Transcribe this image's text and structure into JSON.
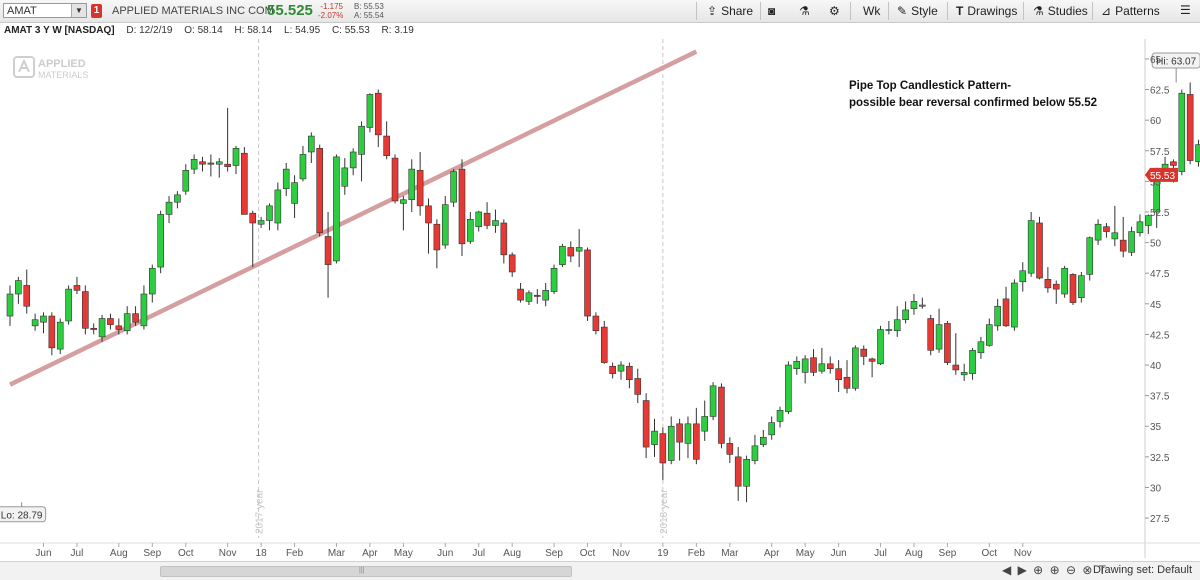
{
  "toolbar": {
    "symbol": "AMAT",
    "alert_count": "1",
    "company_name": "APPLIED MATERIALS INC COM",
    "last_price": "55.525",
    "change": "-1.175",
    "change_pct": "-2.07%",
    "bid": "B: 55.53",
    "ask": "A: 55.54",
    "share_label": "Share",
    "interval_label": "Wk",
    "style_label": "Style",
    "drawings_label": "Drawings",
    "studies_label": "Studies",
    "patterns_label": "Patterns"
  },
  "infobar": {
    "symbol_desc": "AMAT 3 Y W [NASDAQ]",
    "date": "D: 12/2/19",
    "open": "O: 58.14",
    "high": "H: 58.14",
    "low": "L: 54.95",
    "close": "C: 55.53",
    "range": "R: 3.19"
  },
  "bottom": {
    "drawing_set": "Drawing set: Default"
  },
  "colors": {
    "up": "#2ecc40",
    "down": "#e53935",
    "trendline": "#d49a9a",
    "axis_text": "#555555"
  },
  "chart_data": {
    "type": "candlestick",
    "watermark": [
      "APPLIED",
      "MATERIALS"
    ],
    "y_ticks": [
      65,
      62.5,
      60,
      57.5,
      55,
      52.5,
      50,
      47.5,
      45,
      42.5,
      40,
      37.5,
      35,
      32.5,
      30,
      27.5
    ],
    "ylim": [
      26.2,
      66.3
    ],
    "x_labels": [
      {
        "label": "Jun",
        "i": 4
      },
      {
        "label": "Jul",
        "i": 8
      },
      {
        "label": "Aug",
        "i": 13
      },
      {
        "label": "Sep",
        "i": 17
      },
      {
        "label": "Oct",
        "i": 21
      },
      {
        "label": "Nov",
        "i": 26
      },
      {
        "label": "18",
        "i": 30
      },
      {
        "label": "Feb",
        "i": 34
      },
      {
        "label": "Mar",
        "i": 39
      },
      {
        "label": "Apr",
        "i": 43
      },
      {
        "label": "May",
        "i": 47
      },
      {
        "label": "Jun",
        "i": 52
      },
      {
        "label": "Jul",
        "i": 56
      },
      {
        "label": "Aug",
        "i": 60
      },
      {
        "label": "Sep",
        "i": 65
      },
      {
        "label": "Oct",
        "i": 69
      },
      {
        "label": "Nov",
        "i": 73
      },
      {
        "label": "19",
        "i": 78
      },
      {
        "label": "Feb",
        "i": 82
      },
      {
        "label": "Mar",
        "i": 86
      },
      {
        "label": "Apr",
        "i": 91
      },
      {
        "label": "May",
        "i": 95
      },
      {
        "label": "Jun",
        "i": 99
      },
      {
        "label": "Jul",
        "i": 104
      },
      {
        "label": "Aug",
        "i": 108
      },
      {
        "label": "Sep",
        "i": 112
      },
      {
        "label": "Oct",
        "i": 117
      },
      {
        "label": "Nov",
        "i": 121
      }
    ],
    "year_markers": [
      {
        "label": "2017 year",
        "i": 29.7
      },
      {
        "label": "2018 year",
        "i": 78.0
      }
    ],
    "candles": [
      [
        44.0,
        46.5,
        43.2,
        45.8
      ],
      [
        45.8,
        47.2,
        45.0,
        46.9
      ],
      [
        46.5,
        47.8,
        44.2,
        44.8
      ],
      [
        43.2,
        44.2,
        42.8,
        43.7
      ],
      [
        43.5,
        44.3,
        42.6,
        44.0
      ],
      [
        44.0,
        44.3,
        40.8,
        41.4
      ],
      [
        41.3,
        43.8,
        40.9,
        43.5
      ],
      [
        43.6,
        46.5,
        43.3,
        46.2
      ],
      [
        46.5,
        47.2,
        45.8,
        46.1
      ],
      [
        46.0,
        46.5,
        42.5,
        43.0
      ],
      [
        43.0,
        43.4,
        42.5,
        42.9
      ],
      [
        42.3,
        44.1,
        41.9,
        43.8
      ],
      [
        43.8,
        44.2,
        42.9,
        43.3
      ],
      [
        43.2,
        43.8,
        42.5,
        42.9
      ],
      [
        42.8,
        44.8,
        42.5,
        44.2
      ],
      [
        44.2,
        44.8,
        43.2,
        43.5
      ],
      [
        43.2,
        46.5,
        42.9,
        45.8
      ],
      [
        45.8,
        48.2,
        45.1,
        47.9
      ],
      [
        48.0,
        52.6,
        47.5,
        52.3
      ],
      [
        52.3,
        53.8,
        51.6,
        53.3
      ],
      [
        53.3,
        54.2,
        52.8,
        53.9
      ],
      [
        54.2,
        56.4,
        53.9,
        55.9
      ],
      [
        56.0,
        57.2,
        55.6,
        56.8
      ],
      [
        56.6,
        57.0,
        55.8,
        56.4
      ],
      [
        56.5,
        57.2,
        55.4,
        56.4
      ],
      [
        56.4,
        56.9,
        55.3,
        56.6
      ],
      [
        56.4,
        61.0,
        55.8,
        56.2
      ],
      [
        56.3,
        57.9,
        55.6,
        57.7
      ],
      [
        57.3,
        57.8,
        52.3,
        52.3
      ],
      [
        52.4,
        52.6,
        48.0,
        51.6
      ],
      [
        51.5,
        52.1,
        51.2,
        51.8
      ],
      [
        51.8,
        53.2,
        51.0,
        53.0
      ],
      [
        51.6,
        54.9,
        51.0,
        54.3
      ],
      [
        54.4,
        56.5,
        53.8,
        56.0
      ],
      [
        53.2,
        55.5,
        52.0,
        54.9
      ],
      [
        55.2,
        57.9,
        55.0,
        57.2
      ],
      [
        57.4,
        59.0,
        56.5,
        58.7
      ],
      [
        57.7,
        58.0,
        50.5,
        50.8
      ],
      [
        50.5,
        52.5,
        45.5,
        48.2
      ],
      [
        48.5,
        57.2,
        48.3,
        57.0
      ],
      [
        54.6,
        56.9,
        53.9,
        56.1
      ],
      [
        56.1,
        57.7,
        55.5,
        57.4
      ],
      [
        57.2,
        59.9,
        55.0,
        59.5
      ],
      [
        59.4,
        62.2,
        59.0,
        62.1
      ],
      [
        62.2,
        62.5,
        57.8,
        58.8
      ],
      [
        58.7,
        59.9,
        56.8,
        57.1
      ],
      [
        56.9,
        57.2,
        53.2,
        53.4
      ],
      [
        53.2,
        53.8,
        51.0,
        53.5
      ],
      [
        53.5,
        56.8,
        52.5,
        56.0
      ],
      [
        55.9,
        57.4,
        52.2,
        53.0
      ],
      [
        53.0,
        53.6,
        49.1,
        51.6
      ],
      [
        51.5,
        51.9,
        47.9,
        49.4
      ],
      [
        49.8,
        53.8,
        49.5,
        53.1
      ],
      [
        53.3,
        56.0,
        52.9,
        55.8
      ],
      [
        56.0,
        56.8,
        48.9,
        49.9
      ],
      [
        50.1,
        52.5,
        49.9,
        51.9
      ],
      [
        51.3,
        52.6,
        50.9,
        52.5
      ],
      [
        52.4,
        53.3,
        51.1,
        51.4
      ],
      [
        51.4,
        52.7,
        50.8,
        51.8
      ],
      [
        51.6,
        51.9,
        48.3,
        49.0
      ],
      [
        49.0,
        49.2,
        47.2,
        47.6
      ],
      [
        46.2,
        46.7,
        45.1,
        45.3
      ],
      [
        45.2,
        46.1,
        44.9,
        45.9
      ],
      [
        45.7,
        46.2,
        45.0,
        45.6
      ],
      [
        45.3,
        46.7,
        44.8,
        46.1
      ],
      [
        46.0,
        48.2,
        45.8,
        47.9
      ],
      [
        48.2,
        49.9,
        48.0,
        49.7
      ],
      [
        49.6,
        50.1,
        48.4,
        48.9
      ],
      [
        49.3,
        51.1,
        48.0,
        49.6
      ],
      [
        49.4,
        49.6,
        43.6,
        44.0
      ],
      [
        44.0,
        44.3,
        42.5,
        42.8
      ],
      [
        43.1,
        43.6,
        40.1,
        40.2
      ],
      [
        39.9,
        40.2,
        38.9,
        39.3
      ],
      [
        39.5,
        40.3,
        38.8,
        40.0
      ],
      [
        39.9,
        40.2,
        38.1,
        38.8
      ],
      [
        38.9,
        39.7,
        36.9,
        37.6
      ],
      [
        37.1,
        37.7,
        32.4,
        33.3
      ],
      [
        33.5,
        35.6,
        32.5,
        34.6
      ],
      [
        34.4,
        34.9,
        30.6,
        32.0
      ],
      [
        32.2,
        35.8,
        31.9,
        35.0
      ],
      [
        35.2,
        35.6,
        32.2,
        33.7
      ],
      [
        33.6,
        35.8,
        32.4,
        35.2
      ],
      [
        35.2,
        36.5,
        31.9,
        32.3
      ],
      [
        34.6,
        37.1,
        33.8,
        35.8
      ],
      [
        35.8,
        38.6,
        35.5,
        38.3
      ],
      [
        38.2,
        38.5,
        33.2,
        33.6
      ],
      [
        33.6,
        34.1,
        32.0,
        32.7
      ],
      [
        32.5,
        33.3,
        28.9,
        30.1
      ],
      [
        30.1,
        32.6,
        28.8,
        32.3
      ],
      [
        32.2,
        34.3,
        31.9,
        33.4
      ],
      [
        33.5,
        34.7,
        33.3,
        34.1
      ],
      [
        34.3,
        35.8,
        33.9,
        35.3
      ],
      [
        35.4,
        36.6,
        34.9,
        36.3
      ],
      [
        36.2,
        40.3,
        36.0,
        40.0
      ],
      [
        39.7,
        40.7,
        39.2,
        40.3
      ],
      [
        39.4,
        40.8,
        38.5,
        40.5
      ],
      [
        40.6,
        41.3,
        39.1,
        39.4
      ],
      [
        39.5,
        41.4,
        39.3,
        40.1
      ],
      [
        40.1,
        40.7,
        39.3,
        39.7
      ],
      [
        39.7,
        40.4,
        37.8,
        38.8
      ],
      [
        39.0,
        40.4,
        37.7,
        38.1
      ],
      [
        38.1,
        41.6,
        37.9,
        41.4
      ],
      [
        41.3,
        41.6,
        40.0,
        40.7
      ],
      [
        40.5,
        40.6,
        39.0,
        40.3
      ],
      [
        40.1,
        43.2,
        40.0,
        42.9
      ],
      [
        42.9,
        43.6,
        42.5,
        42.9
      ],
      [
        42.8,
        44.8,
        42.3,
        43.7
      ],
      [
        43.7,
        45.2,
        43.4,
        44.5
      ],
      [
        44.6,
        45.8,
        44.1,
        45.2
      ],
      [
        44.8,
        45.5,
        44.6,
        44.9
      ],
      [
        43.8,
        44.1,
        40.8,
        41.2
      ],
      [
        41.3,
        44.6,
        41.0,
        43.3
      ],
      [
        43.4,
        43.6,
        40.0,
        40.2
      ],
      [
        40.0,
        42.6,
        39.2,
        39.6
      ],
      [
        39.2,
        40.1,
        38.7,
        39.4
      ],
      [
        39.3,
        41.4,
        38.8,
        41.2
      ],
      [
        41.0,
        42.3,
        40.5,
        41.9
      ],
      [
        41.6,
        43.8,
        41.5,
        43.3
      ],
      [
        43.2,
        45.4,
        42.8,
        44.8
      ],
      [
        45.4,
        46.4,
        43.1,
        43.2
      ],
      [
        43.1,
        47.0,
        42.8,
        46.7
      ],
      [
        46.8,
        48.4,
        46.0,
        47.7
      ],
      [
        47.5,
        52.5,
        47.2,
        51.8
      ],
      [
        51.6,
        52.1,
        47.0,
        47.1
      ],
      [
        47.0,
        48.0,
        45.9,
        46.3
      ],
      [
        46.6,
        46.9,
        45.0,
        46.2
      ],
      [
        45.8,
        48.1,
        45.5,
        47.9
      ],
      [
        47.4,
        47.5,
        44.9,
        45.1
      ],
      [
        45.5,
        47.6,
        45.1,
        47.3
      ],
      [
        47.4,
        50.5,
        46.9,
        50.4
      ],
      [
        50.2,
        51.9,
        49.8,
        51.5
      ],
      [
        51.3,
        51.6,
        50.4,
        50.9
      ],
      [
        50.3,
        53.0,
        49.7,
        50.8
      ],
      [
        50.2,
        52.1,
        48.8,
        49.3
      ],
      [
        49.2,
        51.3,
        48.9,
        50.9
      ],
      [
        50.8,
        52.3,
        50.5,
        51.7
      ],
      [
        51.4,
        52.3,
        50.7,
        52.2
      ],
      [
        52.5,
        56.1,
        51.2,
        56.0
      ],
      [
        55.9,
        57.0,
        55.1,
        56.4
      ],
      [
        56.6,
        56.8,
        54.9,
        56.3
      ],
      [
        55.8,
        62.5,
        55.5,
        62.2
      ],
      [
        62.1,
        63.07,
        56.4,
        56.7
      ],
      [
        56.6,
        58.4,
        56.2,
        58.0
      ],
      [
        58.14,
        58.14,
        54.95,
        55.53
      ]
    ],
    "hi_label": "Hi: 63.07",
    "lo_label": "Lo: 28.79",
    "hi_value": 63.07,
    "lo_value": 28.79,
    "last_value": 55.53,
    "last_label": "55.53",
    "support_value": 55.52,
    "trendline": {
      "start": {
        "i": 0,
        "price": 38.4
      },
      "end": {
        "i": 82,
        "price": 65.6
      }
    },
    "annotation": [
      "Pipe Top Candlestick Pattern-",
      "possible bear reversal confirmed below 55.52"
    ]
  }
}
